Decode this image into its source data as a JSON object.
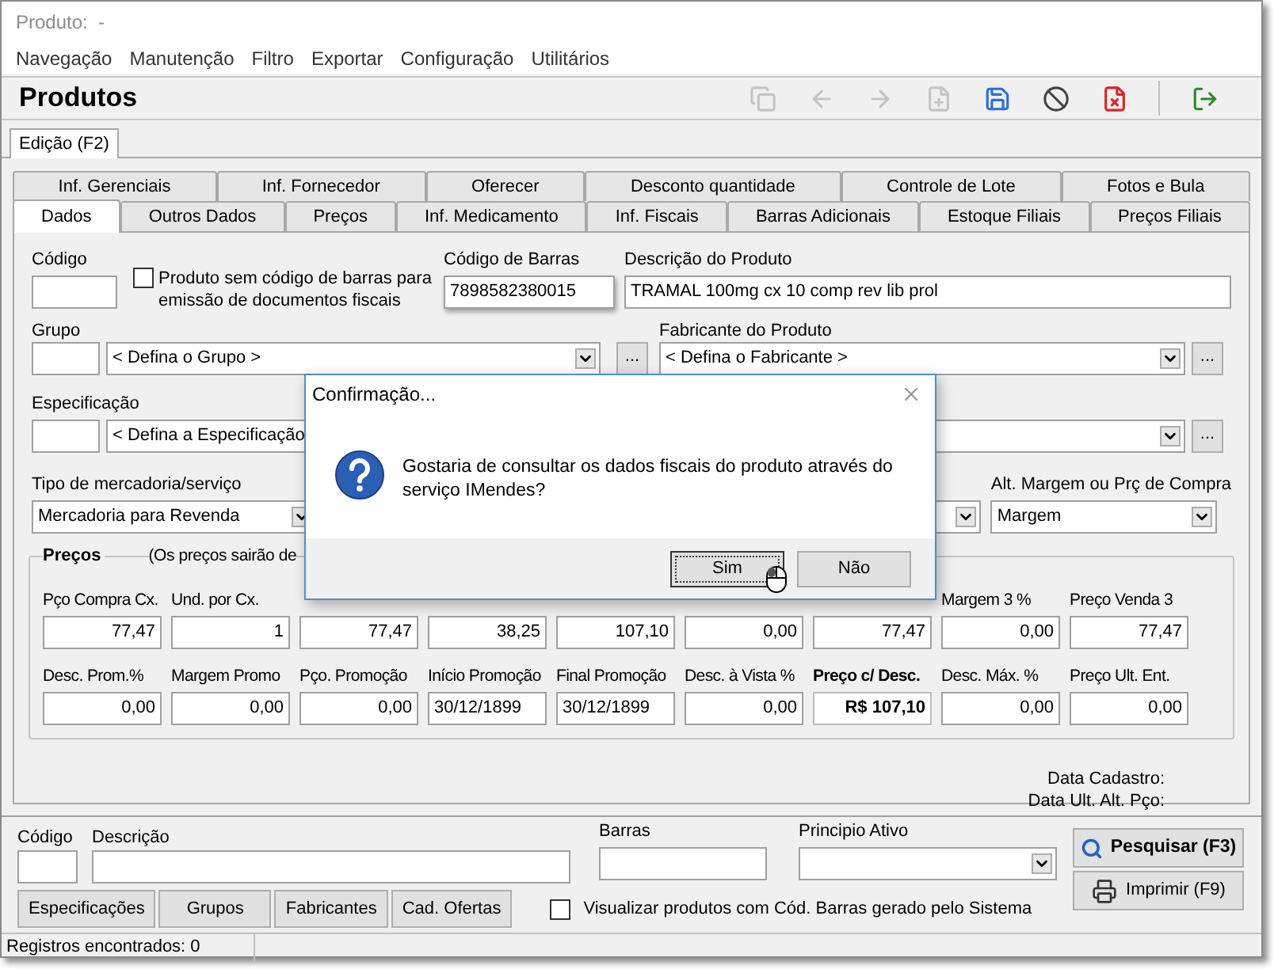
{
  "window": {
    "title": "Produto:  -"
  },
  "menu": [
    "Navegação",
    "Manutenção",
    "Filtro",
    "Exportar",
    "Configuração",
    "Utilitários"
  ],
  "header": {
    "title": "Produtos"
  },
  "toolbar": [
    {
      "kind": "copy",
      "disabled": true
    },
    {
      "kind": "back",
      "disabled": true
    },
    {
      "kind": "forward",
      "disabled": true
    },
    {
      "kind": "new",
      "disabled": true
    },
    {
      "kind": "save",
      "disabled": false
    },
    {
      "kind": "cancel",
      "disabled": false
    },
    {
      "kind": "delete",
      "disabled": false
    },
    {
      "kind": "separator"
    },
    {
      "kind": "exit",
      "disabled": false
    }
  ],
  "mode_tab": {
    "label": "Edição (F2)",
    "selected": true
  },
  "tabs_back": [
    {
      "label": "Inf. Gerenciais",
      "selected": false
    },
    {
      "label": "Inf. Fornecedor",
      "selected": false
    },
    {
      "label": "Oferecer",
      "selected": false
    },
    {
      "label": "Desconto quantidade",
      "selected": false
    },
    {
      "label": "Controle de Lote",
      "selected": false
    },
    {
      "label": "Fotos e Bula",
      "selected": false
    }
  ],
  "tabs_front": [
    {
      "label": "Dados",
      "selected": true
    },
    {
      "label": "Outros Dados",
      "selected": false
    },
    {
      "label": "Preços",
      "selected": false
    },
    {
      "label": "Inf. Medicamento",
      "selected": false
    },
    {
      "label": "Inf. Fiscais",
      "selected": false
    },
    {
      "label": "Barras Adicionais",
      "selected": false
    },
    {
      "label": "Estoque Filiais",
      "selected": false
    },
    {
      "label": "Preços Filiais",
      "selected": false
    }
  ],
  "form": {
    "codigo": {
      "label": "Código"
    },
    "no_barcode": {
      "label": "Produto sem código de barras para emissão de documentos fiscais",
      "checked": false
    },
    "barcode": {
      "label": "Código de Barras",
      "value": "7898582380015"
    },
    "descricao": {
      "label": "Descrição do Produto",
      "value": "TRAMAL 100mg cx 10 comp rev lib prol"
    },
    "grupo": {
      "label": "Grupo",
      "value": "< Defina o Grupo >",
      "browse": "..."
    },
    "fabricante": {
      "label": "Fabricante do Produto",
      "value": "< Defina o Fabricante >",
      "browse": "..."
    },
    "especificacao": {
      "label": "Especificação",
      "value": "< Defina a Especificação"
    },
    "field_right_3": {
      "browse": "..."
    },
    "tipo": {
      "label": "Tipo de mercadoria/serviço",
      "value": "Mercadoria para Revenda"
    },
    "alt_margem": {
      "label": "Alt. Margem ou Prç de Compra",
      "value": "Margem"
    }
  },
  "precos": {
    "title": "Preços",
    "note": "(Os preços sairão de",
    "row_1": [
      {
        "label": "Pço Compra Cx.",
        "value": "77,47",
        "kind": "number"
      },
      {
        "label": "Und. por Cx.",
        "value": "1",
        "kind": "number"
      },
      {
        "value": "77,47",
        "kind": "number"
      },
      {
        "value": "38,25",
        "kind": "number"
      },
      {
        "value": "107,10",
        "kind": "number"
      },
      {
        "value": "0,00",
        "kind": "number"
      },
      {
        "value": "77,47",
        "kind": "number"
      },
      {
        "label": "Margem 3 %",
        "value": "0,00",
        "kind": "number"
      },
      {
        "label": "Preço Venda 3",
        "value": "77,47",
        "kind": "number"
      }
    ],
    "row_2": [
      {
        "label": "Desc. Prom.%",
        "value": "0,00",
        "kind": "number"
      },
      {
        "label": "Margem Promo",
        "value": "0,00",
        "kind": "number"
      },
      {
        "label": "Pço. Promoção",
        "value": "0,00",
        "kind": "number"
      },
      {
        "label": "Início Promoção",
        "value": "30/12/1899",
        "kind": "date"
      },
      {
        "label": "Final Promoção",
        "value": "30/12/1899",
        "kind": "date"
      },
      {
        "label": "Desc. à Vista %",
        "value": "0,00",
        "kind": "number"
      },
      {
        "label": "Preço c/ Desc.",
        "value": "R$ 107,10",
        "kind": "highlight"
      },
      {
        "label": "Desc. Máx. %",
        "value": "0,00",
        "kind": "number"
      },
      {
        "label": "Preço Ult. Ent.",
        "value": "0,00",
        "kind": "number"
      }
    ]
  },
  "dates": [
    "Data Cadastro:",
    "Data Ult. Alt. Pço:"
  ],
  "search": {
    "codigo": "Código",
    "descricao": "Descrição",
    "barras": "Barras",
    "principio": "Principio Ativo",
    "search_button": "Pesquisar (F3)",
    "print_button": "Imprimir (F9)",
    "buttons": [
      "Especificações",
      "Grupos",
      "Fabricantes",
      "Cad. Ofertas"
    ],
    "system_barcode": {
      "label": "Visualizar produtos com Cód. Barras gerado pelo Sistema",
      "checked": false
    }
  },
  "status_bar": "Registros encontrados: 0",
  "dialog": {
    "title": "Confirmação...",
    "message": "Gostaria de consultar os dados fiscais do produto através do serviço IMendes?",
    "buttons": [
      {
        "label": "Sim",
        "focused": true
      },
      {
        "label": "Não",
        "focused": false
      }
    ]
  }
}
